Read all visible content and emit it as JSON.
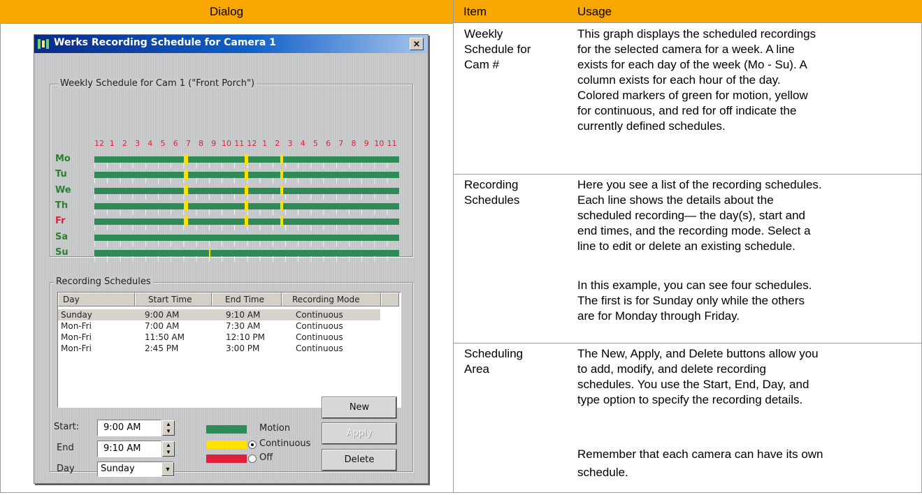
{
  "table_headers": {
    "dialog": "Dialog",
    "item": "Item",
    "usage": "Usage"
  },
  "rows": [
    {
      "item": [
        "Weekly",
        "Schedule for",
        "Cam #"
      ],
      "usage": [
        "This graph displays the scheduled recordings",
        "for the selected camera for a week. A line",
        "exists for each day of the week (Mo - Su).  A",
        "column exists for each hour of the day.",
        "Colored markers of green for motion, yellow",
        "for continuous, and red for off indicate the",
        "currently defined schedules."
      ]
    },
    {
      "item": [
        "Recording",
        "Schedules"
      ],
      "usage": [
        "Here you see a list of the recording schedules.",
        "Each line shows the details about the",
        "scheduled recording— the day(s), start and",
        "end times, and the recording mode. Select a",
        "line to edit or delete an existing schedule."
      ],
      "usage2": [
        "In this example, you can see four schedules.",
        "The first is for Sunday only while the others",
        "are for Monday through Friday."
      ]
    },
    {
      "item": [
        "Scheduling",
        "Area"
      ],
      "usage": [
        "The New, Apply, and Delete buttons allow you",
        "to add, modify, and delete recording",
        "schedules. You use the Start, End, Day, and",
        "type option to specify the recording details."
      ],
      "usage2": [
        "Remember that each camera can have its own",
        "schedule."
      ]
    }
  ],
  "dialog": {
    "title": "Werks Recording Schedule for Camera 1",
    "close": "×",
    "weekly_group": "Weekly Schedule for Cam 1 (\"Front Porch\")",
    "hours": [
      "12",
      "1",
      "2",
      "3",
      "4",
      "5",
      "6",
      "7",
      "8",
      "9",
      "10",
      "11",
      "12",
      "1",
      "2",
      "3",
      "4",
      "5",
      "6",
      "7",
      "8",
      "9",
      "10",
      "11"
    ],
    "days": [
      {
        "label": "Mo",
        "color": "#2e7d32"
      },
      {
        "label": "Tu",
        "color": "#2e7d32"
      },
      {
        "label": "We",
        "color": "#2e7d32"
      },
      {
        "label": "Th",
        "color": "#2e7d32"
      },
      {
        "label": "Fr",
        "color": "#d1283f"
      },
      {
        "label": "Sa",
        "color": "#2e7d32"
      },
      {
        "label": "Su",
        "color": "#2e7d32"
      }
    ],
    "schedules_group": "Recording Schedules",
    "columns": [
      "Day",
      "Start Time",
      "End Time",
      "Recording Mode"
    ],
    "schedules": [
      {
        "day": "Sunday",
        "start": "9:00 AM",
        "end": "9:10 AM",
        "mode": "Continuous"
      },
      {
        "day": "Mon-Fri",
        "start": "7:00 AM",
        "end": "7:30 AM",
        "mode": "Continuous"
      },
      {
        "day": "Mon-Fri",
        "start": "11:50 AM",
        "end": "12:10 PM",
        "mode": "Continuous"
      },
      {
        "day": "Mon-Fri",
        "start": "2:45 PM",
        "end": "3:00 PM",
        "mode": "Continuous"
      }
    ],
    "start_label": "Start:",
    "start_value": "9:00 AM",
    "end_label": "End",
    "end_value": "9:10 AM",
    "day_label": "Day",
    "day_value": "Sunday",
    "legend": {
      "motion": "Motion",
      "continuous": "Continuous",
      "off": "Off"
    },
    "colors": {
      "motion": "#2e8b57",
      "continuous": "#ffe100",
      "off": "#e0203a",
      "title_bar": "#0b2a86",
      "header": "#f7a700"
    },
    "selected_mode": "continuous",
    "buttons": {
      "new": "New",
      "apply": "Apply",
      "delete": "Delete"
    },
    "icons": {
      "app": "camera-app-icon",
      "close": "close-icon",
      "spin": "spin-arrows-icon",
      "dropdown": "chevron-down-icon"
    }
  }
}
